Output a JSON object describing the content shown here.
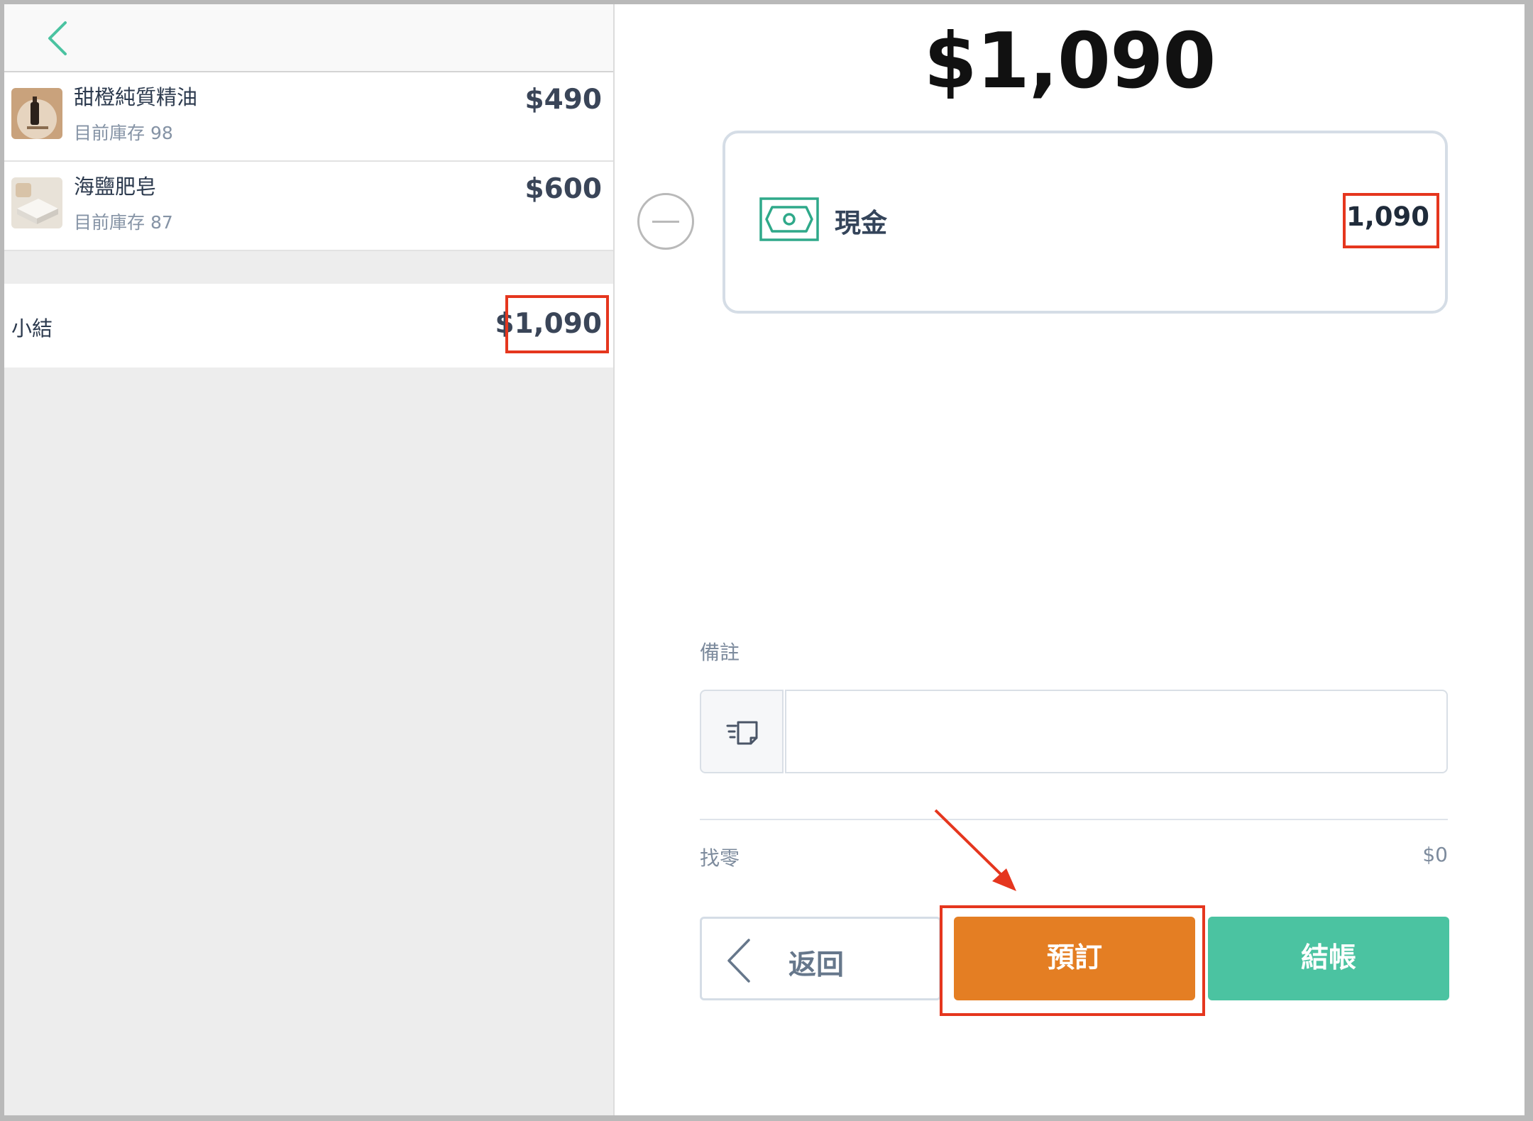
{
  "cart": {
    "items": [
      {
        "name": "甜橙純質精油",
        "stock": "目前庫存 98",
        "price": "$490"
      },
      {
        "name": "海鹽肥皂",
        "stock": "目前庫存 87",
        "price": "$600"
      }
    ],
    "subtotal_label": "小結",
    "subtotal_value": "$1,090"
  },
  "payment": {
    "total": "$1,090",
    "method_label": "現金",
    "method_amount": "1,090"
  },
  "notes": {
    "label": "備註",
    "value": "",
    "placeholder": ""
  },
  "change": {
    "label": "找零",
    "value": "$0"
  },
  "actions": {
    "back_label": "返回",
    "reserve_label": "預訂",
    "checkout_label": "結帳"
  },
  "colors": {
    "accent_green": "#4bc3a1",
    "reserve_orange": "#e47e23",
    "highlight_red": "#e5361e"
  },
  "icons": {
    "back": "chevron-left-icon",
    "cash": "cash-icon",
    "remove": "minus-circle-icon",
    "notes": "note-icon"
  }
}
